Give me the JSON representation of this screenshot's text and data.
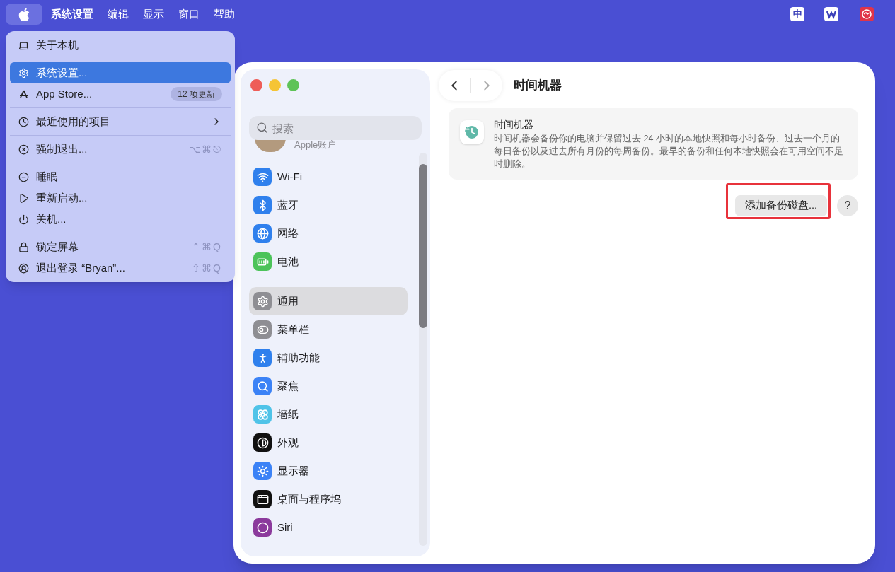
{
  "menu_bar": {
    "apple_selected": true,
    "items": [
      {
        "label": "系统设置"
      },
      {
        "label": "编辑"
      },
      {
        "label": "显示"
      },
      {
        "label": "窗口"
      },
      {
        "label": "帮助"
      }
    ],
    "status": {
      "input_method": "中"
    }
  },
  "apple_menu": {
    "groups": [
      [
        {
          "label": "关于本机",
          "selected": false
        }
      ],
      [
        {
          "label": "系统设置...",
          "selected": true
        },
        {
          "label": "App Store...",
          "badge": "12 项更新",
          "selected": false
        }
      ],
      [
        {
          "label": "最近使用的项目",
          "submenu": true,
          "selected": false
        }
      ],
      [
        {
          "label": "强制退出...",
          "shortcut": "⌥⌘⎋",
          "selected": false
        }
      ],
      [
        {
          "label": "睡眠",
          "selected": false
        },
        {
          "label": "重新启动...",
          "selected": false
        },
        {
          "label": "关机...",
          "selected": false
        }
      ],
      [
        {
          "label": "锁定屏幕",
          "shortcut": "⌃⌘Q",
          "selected": false
        },
        {
          "label": "退出登录 “Bryan”...",
          "shortcut": "⇧⌘Q",
          "selected": false
        }
      ]
    ]
  },
  "window": {
    "search": {
      "placeholder": "搜索"
    },
    "account": {
      "label": "Apple账户"
    },
    "sidebar": {
      "groups": [
        [
          {
            "label": "Wi-Fi",
            "color": "#2f80ed",
            "selected": false
          },
          {
            "label": "蓝牙",
            "color": "#2f80ed",
            "selected": false
          },
          {
            "label": "网络",
            "color": "#2f80ed",
            "selected": false
          },
          {
            "label": "电池",
            "color": "#4cc35a",
            "selected": false
          }
        ],
        [
          {
            "label": "通用",
            "color": "#8e8e93",
            "selected": true
          },
          {
            "label": "菜单栏",
            "color": "#8e8e93",
            "selected": false
          },
          {
            "label": "辅助功能",
            "color": "#2f80ed",
            "selected": false
          },
          {
            "label": "聚焦",
            "color": "#3b82f6",
            "selected": false
          },
          {
            "label": "墙纸",
            "color": "#4fc3e8",
            "selected": false
          },
          {
            "label": "外观",
            "color": "#111111",
            "selected": false
          },
          {
            "label": "显示器",
            "color": "#3b82f6",
            "selected": false
          },
          {
            "label": "桌面与程序坞",
            "color": "#111111",
            "selected": false
          },
          {
            "label": "Siri",
            "color": "#8b3a9c",
            "selected": false
          }
        ]
      ]
    },
    "title": "时间机器",
    "card": {
      "title": "时间机器",
      "description": "时间机器会备份你的电脑并保留过去 24 小时的本地快照和每小时备份、过去一个月的每日备份以及过去所有月份的每周备份。最早的备份和任何本地快照会在可用空间不足时删除。"
    },
    "add_button": {
      "label": "添加备份磁盘...",
      "highlighted": true
    },
    "help_button": {
      "label": "?"
    }
  }
}
